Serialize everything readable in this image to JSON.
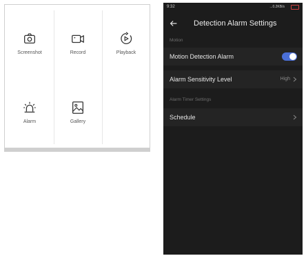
{
  "left_panel": {
    "tiles": [
      {
        "label": "Screenshot",
        "icon": "camera-icon"
      },
      {
        "label": "Record",
        "icon": "video-record-icon"
      },
      {
        "label": "Playback",
        "icon": "playback-icon"
      },
      {
        "label": "Alarm",
        "icon": "alarm-light-icon"
      },
      {
        "label": "Gallery",
        "icon": "gallery-icon"
      }
    ]
  },
  "phone": {
    "status_bar": {
      "time": "9:32",
      "network": "...0.2KB/s"
    },
    "header": {
      "title": "Detection Alarm Settings",
      "back_icon": "back-arrow-icon"
    },
    "sections": [
      {
        "title": "Motion"
      },
      {
        "title": "Alarm Timer Settings"
      }
    ],
    "rows": {
      "motion_detection": {
        "label": "Motion Detection Alarm",
        "enabled": true
      },
      "sensitivity": {
        "label": "Alarm Sensitivity Level",
        "value": "High"
      },
      "schedule": {
        "label": "Schedule"
      }
    },
    "colors": {
      "background": "#1c1c1c",
      "row": "#242424",
      "toggle_on": "#4a6fd8"
    }
  }
}
